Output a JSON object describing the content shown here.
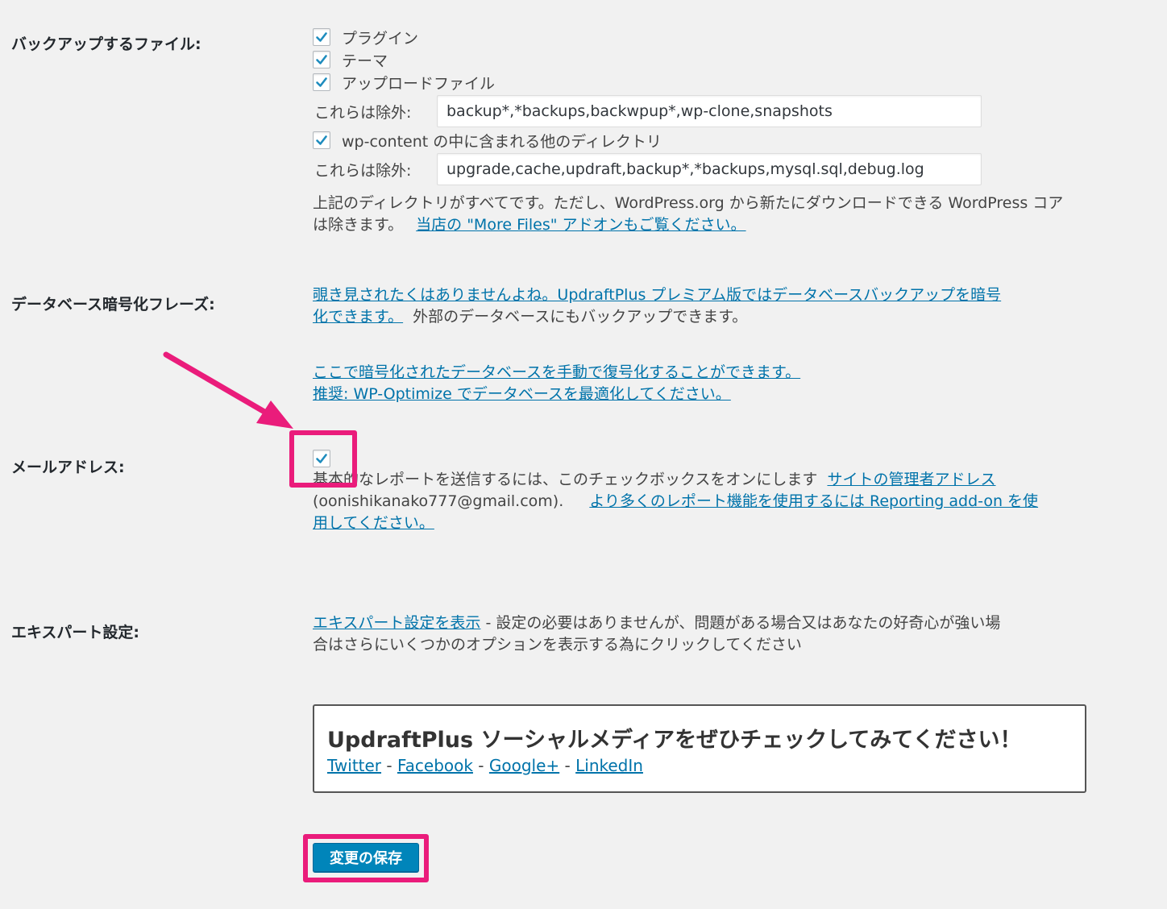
{
  "files": {
    "label": "バックアップするファイル:",
    "plugins_label": "プラグイン",
    "themes_label": "テーマ",
    "uploads_label": "アップロードファイル",
    "exclude_label": "これらは除外:",
    "exclude_value_1": "backup*,*backups,backwpup*,wp-clone,snapshots",
    "others_label": "wp-content の中に含まれる他のディレクトリ",
    "exclude_value_2": "upgrade,cache,updraft,backup*,*backups,mysql.sql,debug.log",
    "note_line1": "上記のディレクトリがすべてです。ただし、WordPress.org から新たにダウンロードできる WordPress コア",
    "note_line2": "は除きます。",
    "more_files_link": "当店の \"More Files\" アドオンもご覧ください。"
  },
  "db_encryption": {
    "label": "データベース暗号化フレーズ:",
    "premium_link_line1": "覗き見されたくはありませんよね。UpdraftPlus プレミアム版ではデータベースバックアップを暗号",
    "premium_link_line2": "化できます。",
    "external_text": "外部のデータベースにもバックアップできます。",
    "decrypt_link": "ここで暗号化されたデータベースを手動で復号化することができます。",
    "optimize_link": "推奨: WP-Optimize でデータベースを最適化してください。"
  },
  "email": {
    "label": "メールアドレス:",
    "text_start": "基本的なレポートを送信するには、このチェックボックスをオンにします",
    "admin_link": "サイトの管理者アドレス",
    "address": "(oonishikanako777@gmail.com).",
    "reporting_link_line1": "より多くのレポート機能を使用するには Reporting add-on を使",
    "reporting_link_line2": "用してください。"
  },
  "expert": {
    "label": "エキスパート設定:",
    "link": "エキスパート設定を表示",
    "text_line1": " - 設定の必要はありませんが、問題がある場合又はあなたの好奇心が強い場",
    "text_line2": "合はさらにいくつかのオプションを表示する為にクリックしてください"
  },
  "social": {
    "title": "UpdraftPlus ソーシャルメディアをぜひチェックしてみてください！",
    "twitter": "Twitter",
    "facebook": "Facebook",
    "google": "Google+",
    "linkedin": "LinkedIn",
    "separator": " - "
  },
  "save_button": "変更の保存",
  "colors": {
    "link": "#0073aa",
    "button": "#0085ba",
    "highlight": "#ea1c7b",
    "background": "#f1f1f1"
  }
}
